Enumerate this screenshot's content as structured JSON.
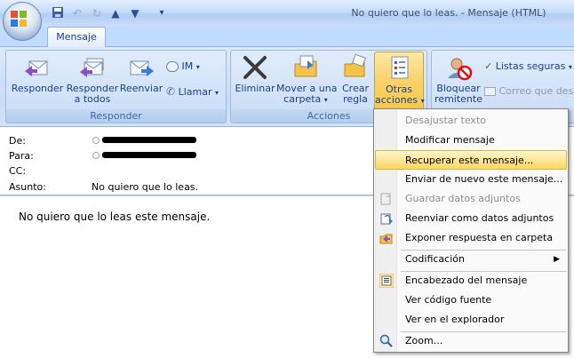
{
  "window": {
    "title": "No quiero que lo leas. - Mensaje (HTML)"
  },
  "tabs": [
    {
      "label": "Mensaje"
    }
  ],
  "ribbon": {
    "responder_group": {
      "label": "Responder",
      "reply": "Responder",
      "reply_all_1": "Responder",
      "reply_all_2": "a todos",
      "forward": "Reenviar",
      "im": "IM",
      "call": "Llamar"
    },
    "acciones_group": {
      "label": "Acciones",
      "delete": "Eliminar",
      "move_1": "Mover a una",
      "move_2": "carpeta",
      "create_1": "Crear",
      "create_2": "regla",
      "other_1": "Otras",
      "other_2": "acciones"
    },
    "junk_group": {
      "block_1": "Bloquear",
      "block_2": "remitente",
      "safe_lists": "Listas seguras",
      "junk_email": "Correo que desea"
    }
  },
  "header": {
    "from_label": "De:",
    "to_label": "Para:",
    "cc_label": "CC:",
    "subject_label": "Asunto:",
    "subject": "No quiero que lo leas."
  },
  "body": {
    "text": "No quiero que lo leas este mensaje."
  },
  "menu": {
    "items": [
      {
        "label": "Desajustar texto",
        "disabled": true
      },
      {
        "label": "Modificar mensaje"
      },
      {
        "label": "Recuperar este mensaje...",
        "highlighted": true
      },
      {
        "label": "Enviar de nuevo este mensaje..."
      },
      {
        "label": "Guardar datos adjuntos",
        "disabled": true
      },
      {
        "label": "Reenviar como datos adjuntos"
      },
      {
        "label": "Exponer respuesta en carpeta"
      },
      {
        "label": "Codificación"
      },
      {
        "label": "Encabezado del mensaje"
      },
      {
        "label": "Ver código fuente"
      },
      {
        "label": "Ver en el explorador"
      },
      {
        "label": "Zoom..."
      }
    ]
  },
  "colors": {
    "ribbon_blue": "#bfdbff",
    "highlight": "#ffe698",
    "text_blue": "#15428b"
  }
}
